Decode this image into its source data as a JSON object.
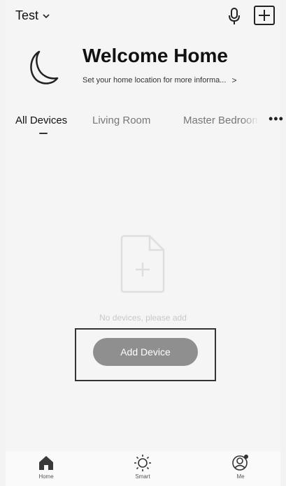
{
  "header": {
    "home_name": "Test",
    "chevron_icon": "chevron-down-icon",
    "mic_icon": "microphone-icon",
    "add_icon": "plus-icon"
  },
  "welcome": {
    "icon": "moon-icon",
    "title": "Welcome Home",
    "subtitle": "Set your home location for more informa...",
    "arrow": ">"
  },
  "tabs": [
    {
      "label": "All Devices",
      "active": true
    },
    {
      "label": "Living Room",
      "active": false
    },
    {
      "label": "Master Bedroom",
      "active": false
    }
  ],
  "more_label": "•••",
  "empty_state": {
    "icon": "add-file-icon",
    "text": "No devices, please add",
    "button_label": "Add Device"
  },
  "bottom_nav": [
    {
      "label": "Home",
      "icon": "home-icon"
    },
    {
      "label": "Smart",
      "icon": "sun-icon"
    },
    {
      "label": "Me",
      "icon": "user-icon"
    }
  ],
  "colors": {
    "button_bg": "#8f8f8f",
    "background": "#f5f5f5",
    "text_dark": "#111111",
    "text_muted": "#c8c8c8"
  }
}
